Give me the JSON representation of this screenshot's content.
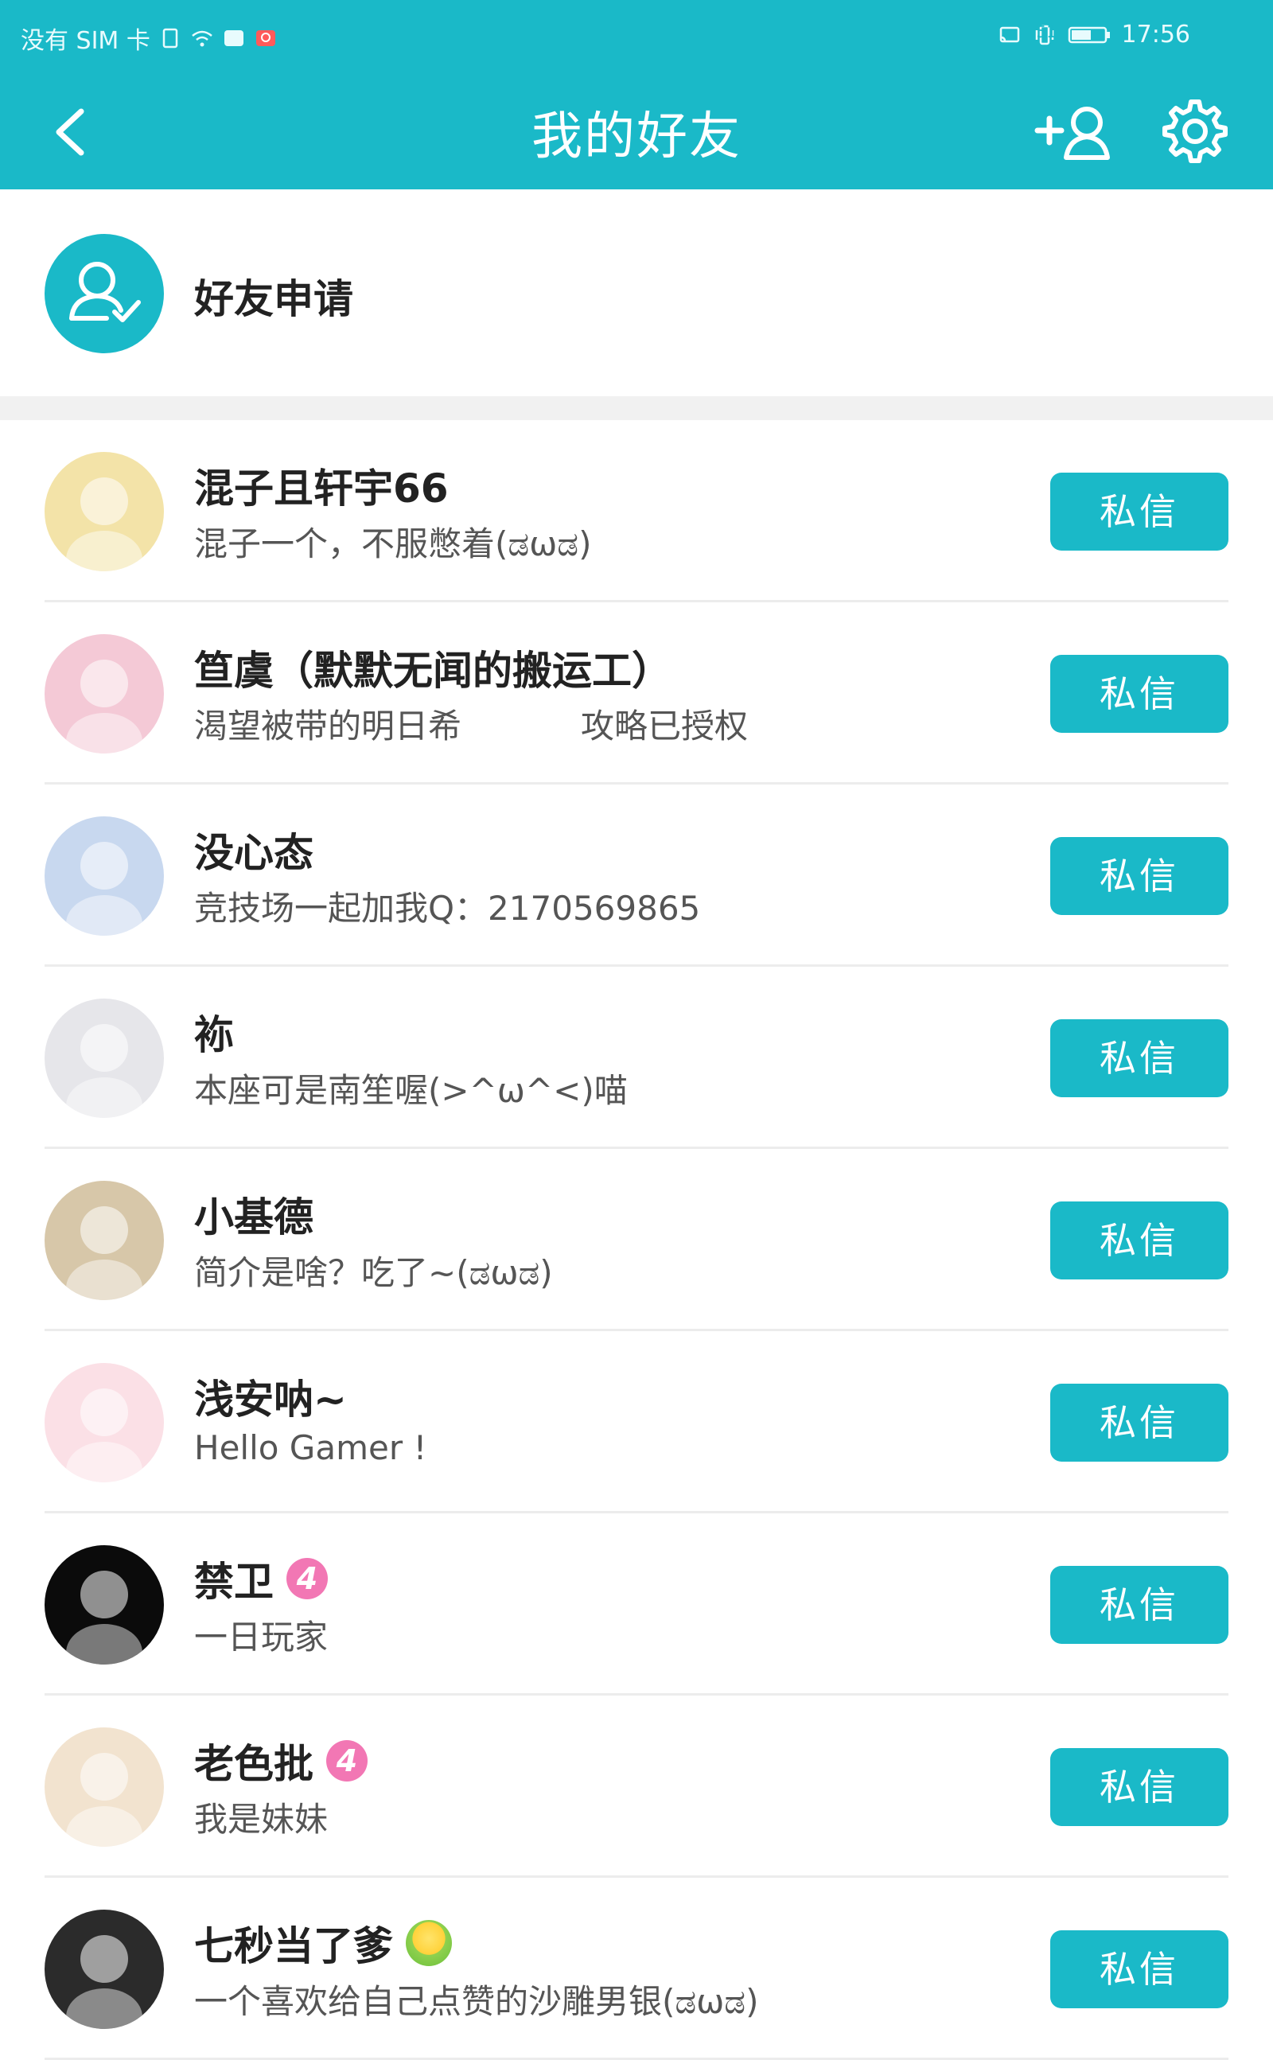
{
  "status_bar": {
    "carrier": "没有 SIM 卡",
    "battery": "51",
    "time": "17:56"
  },
  "header": {
    "title": "我的好友",
    "back_icon": "chevron-left-icon",
    "add_friend_icon": "add-user-icon",
    "settings_icon": "gear-icon"
  },
  "friend_request": {
    "label": "好友申请",
    "icon": "user-check-icon"
  },
  "friends": [
    {
      "name": "混子且轩宇66",
      "bio": "混子一个，不服憋着(ಡωಡ)",
      "bio_extra": "",
      "level": "",
      "button": "私信",
      "avatar_color": "#f3e3a8"
    },
    {
      "name": "笪虞（默默无闻的搬运工）",
      "bio": "渴望被带的明日希",
      "bio_extra": "攻略已授权",
      "level": "",
      "button": "私信",
      "avatar_color": "#f4c9d6"
    },
    {
      "name": "没心态",
      "bio": "竞技场一起加我Q：2170569865",
      "bio_extra": "",
      "level": "",
      "button": "私信",
      "avatar_color": "#c8d8ef"
    },
    {
      "name": "袮",
      "bio": "本座可是南笙喔(>^ω^<)喵",
      "bio_extra": "",
      "level": "",
      "button": "私信",
      "avatar_color": "#e6e6ea"
    },
    {
      "name": "小基德",
      "bio": "简介是啥？吃了~(ಡωಡ)",
      "bio_extra": "",
      "level": "",
      "button": "私信",
      "avatar_color": "#d7c7a9"
    },
    {
      "name": "浅安呐~",
      "bio": "Hello Gamer !",
      "bio_extra": "",
      "level": "",
      "button": "私信",
      "avatar_color": "#fbe0e6"
    },
    {
      "name": "禁卫",
      "bio": "一日玩家",
      "bio_extra": "",
      "level": "4",
      "button": "私信",
      "avatar_color": "#0b0b0b"
    },
    {
      "name": "老色批",
      "bio": "我是妹妹",
      "bio_extra": "",
      "level": "4",
      "button": "私信",
      "avatar_color": "#f2e3cf"
    },
    {
      "name": "七秒当了爹",
      "bio": "一个喜欢给自己点赞的沙雕男银(ಡωಡ)",
      "bio_extra": "",
      "level": "",
      "button": "私信",
      "avatar_color": "#2b2b2b"
    }
  ],
  "colors": {
    "accent": "#1ab9c8",
    "level_badge": "#f277b4"
  }
}
